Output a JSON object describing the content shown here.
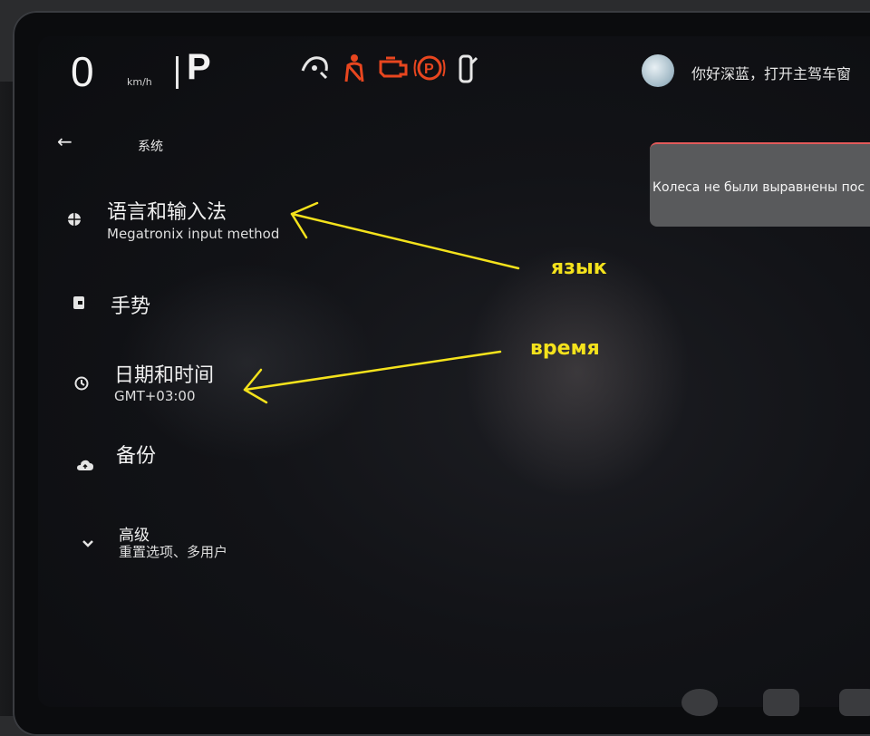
{
  "status_bar": {
    "speed": "0",
    "speed_unit": "km/h",
    "gear": "P",
    "warning_icons": [
      {
        "name": "steering-warning-icon",
        "glyph": "🛞",
        "color": "#e6e6e6"
      },
      {
        "name": "seatbelt-warning-icon",
        "glyph": "♙",
        "color": "#e8461f"
      },
      {
        "name": "engine-warning-icon",
        "glyph": "⚙",
        "color": "#e8461f"
      },
      {
        "name": "parking-brake-icon",
        "glyph": "Ⓟ",
        "color": "#e8461f"
      },
      {
        "name": "door-open-icon",
        "glyph": "▯",
        "color": "#e6e6e6"
      }
    ],
    "greeting": "你好深蓝，打开主驾车窗"
  },
  "header": {
    "back_icon": "back-arrow-icon",
    "title": "系统"
  },
  "settings": {
    "items": [
      {
        "name": "language-input",
        "icon": "globe-icon",
        "title": "语言和输入法",
        "subtitle": "Megatronix input method"
      },
      {
        "name": "gestures",
        "icon": "gesture-icon",
        "title": "手势",
        "subtitle": ""
      },
      {
        "name": "date-time",
        "icon": "clock-icon",
        "title": "日期和时间",
        "subtitle": "GMT+03:00"
      },
      {
        "name": "backup",
        "icon": "cloud-icon",
        "title": "备份",
        "subtitle": ""
      },
      {
        "name": "advanced",
        "icon": "chevron-down-icon",
        "title": "高级",
        "subtitle": "重置选项、多用户"
      }
    ]
  },
  "toast": {
    "text": "Колеса не были выравнены пос"
  },
  "annotations": {
    "language_label": "язык",
    "time_label": "время",
    "color": "#f4e21c"
  }
}
